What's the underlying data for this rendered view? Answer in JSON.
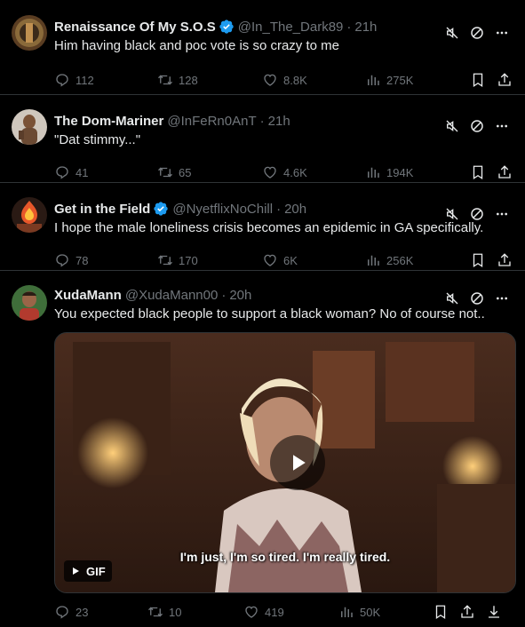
{
  "tweets": [
    {
      "name": "Renaissance Of My S.O.S",
      "handle": "@In_The_Dark89",
      "time": "21h",
      "verified": true,
      "text": "Him having black and poc vote is so crazy to me",
      "replies": "112",
      "retweets": "128",
      "likes": "8.8K",
      "views": "275K"
    },
    {
      "name": "The Dom-Mariner",
      "handle": "@InFeRn0AnT",
      "time": "21h",
      "verified": false,
      "text": "\"Dat stimmy...\"",
      "replies": "41",
      "retweets": "65",
      "likes": "4.6K",
      "views": "194K"
    },
    {
      "name": "Get in the Field",
      "handle": "@NyetflixNoChill",
      "time": "20h",
      "verified": true,
      "text": "I hope the male loneliness crisis becomes an epidemic in GA specifically.",
      "replies": "78",
      "retweets": "170",
      "likes": "6K",
      "views": "256K"
    },
    {
      "name": "XudaMann",
      "handle": "@XudaMann00",
      "time": "20h",
      "verified": false,
      "text": "You expected black people to support a black woman? No of course not..",
      "replies": "23",
      "retweets": "10",
      "likes": "419",
      "views": "50K",
      "media": {
        "badge": "GIF",
        "caption": "I'm just, I'm so tired. I'm really tired."
      }
    }
  ],
  "separator": "·",
  "icons": {
    "mute": "mute-icon",
    "block": "block-icon",
    "more": "more-icon",
    "reply": "reply-icon",
    "retweet": "retweet-icon",
    "like": "like-icon",
    "views": "views-icon",
    "bookmark": "bookmark-icon",
    "share": "share-icon",
    "verified": "verified-badge-icon",
    "play": "play-icon"
  },
  "colors": {
    "background": "#000000",
    "text": "#e7e9ea",
    "secondary": "#71767b",
    "verified": "#1d9bf0",
    "divider": "#2f3336"
  }
}
